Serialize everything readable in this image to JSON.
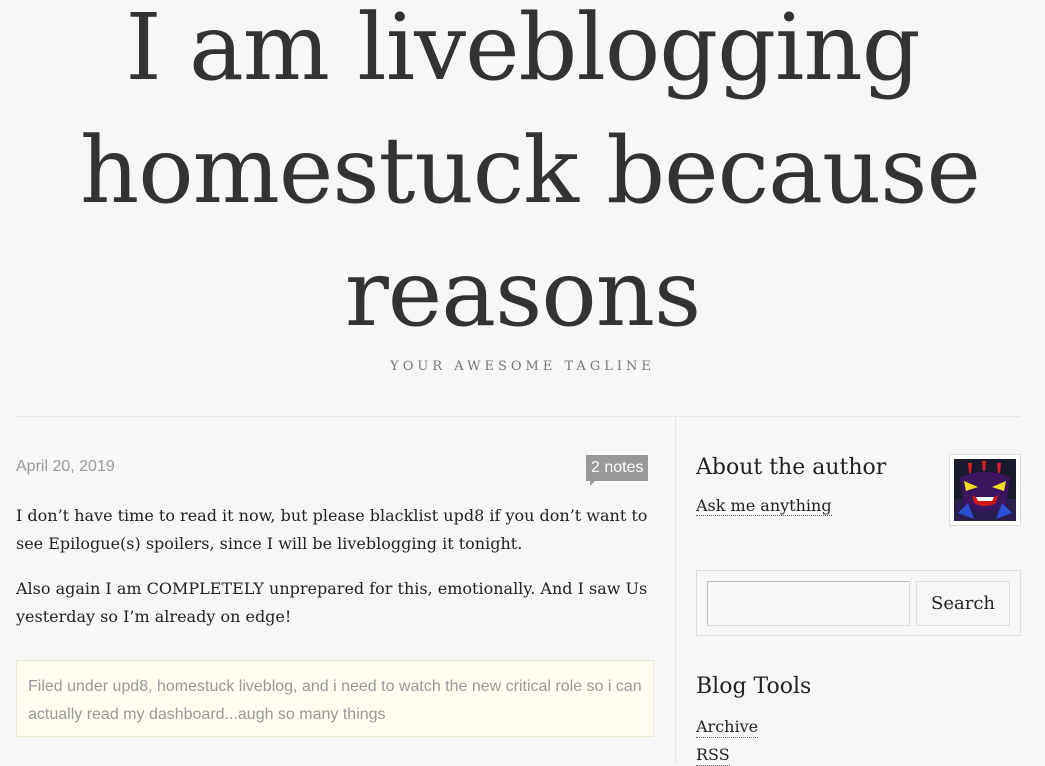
{
  "header": {
    "title_lines": [
      "I am liveblogging",
      "homestuck because",
      "reasons"
    ],
    "tagline": "YOUR AWESOME TAGLINE"
  },
  "post": {
    "date": "April 20, 2019",
    "notes": "2 notes",
    "paragraphs": [
      "I don’t have time to read it now, but please blacklist upd8 if you don’t want to see Epilogue(s) spoilers, since I will be liveblogging it tonight.",
      "Also again I am COMPLETELY unprepared for this, emotionally. And I saw Us yesterday so I’m already on edge!"
    ],
    "filed_under_label": "Filed under",
    "tags": [
      "upd8",
      "homestuck liveblog",
      "i need to watch the new critical role so i can actually read my dashboard...augh so many things"
    ]
  },
  "sidebar": {
    "about_title": "About the author",
    "ask_link": "Ask me anything",
    "search": {
      "placeholder": "",
      "button_label": "Search"
    },
    "tools_title": "Blog Tools",
    "tools": [
      "Archive",
      "RSS"
    ]
  },
  "colors": {
    "background": "#f7f7f7",
    "text": "#333333",
    "muted": "#999999",
    "tags_bg": "#fffdf0"
  }
}
